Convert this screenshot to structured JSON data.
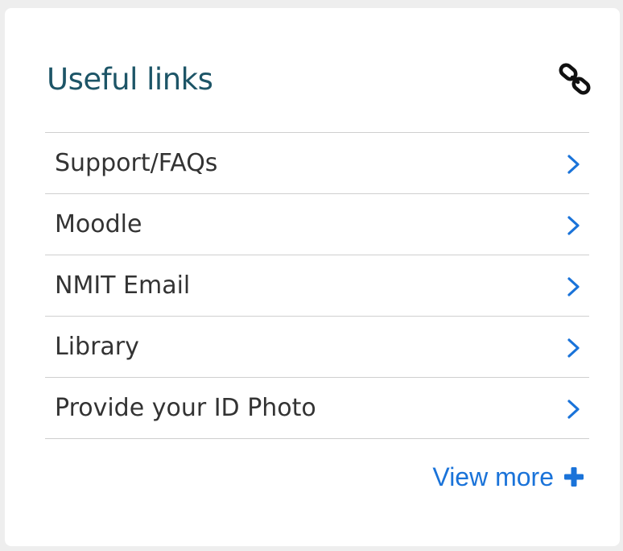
{
  "widget": {
    "title": "Useful links",
    "header_icon": "chain-link-icon",
    "accent_color": "#1d5567",
    "link_color": "#1a73d9",
    "items": [
      {
        "label": "Support/FAQs",
        "icon": "chevron-right-icon"
      },
      {
        "label": "Moodle",
        "icon": "chevron-right-icon"
      },
      {
        "label": "NMIT Email",
        "icon": "chevron-right-icon"
      },
      {
        "label": "Library",
        "icon": "chevron-right-icon"
      },
      {
        "label": "Provide your ID Photo",
        "icon": "chevron-right-icon"
      }
    ],
    "view_more": {
      "label": "View more",
      "icon": "plus-icon"
    }
  }
}
